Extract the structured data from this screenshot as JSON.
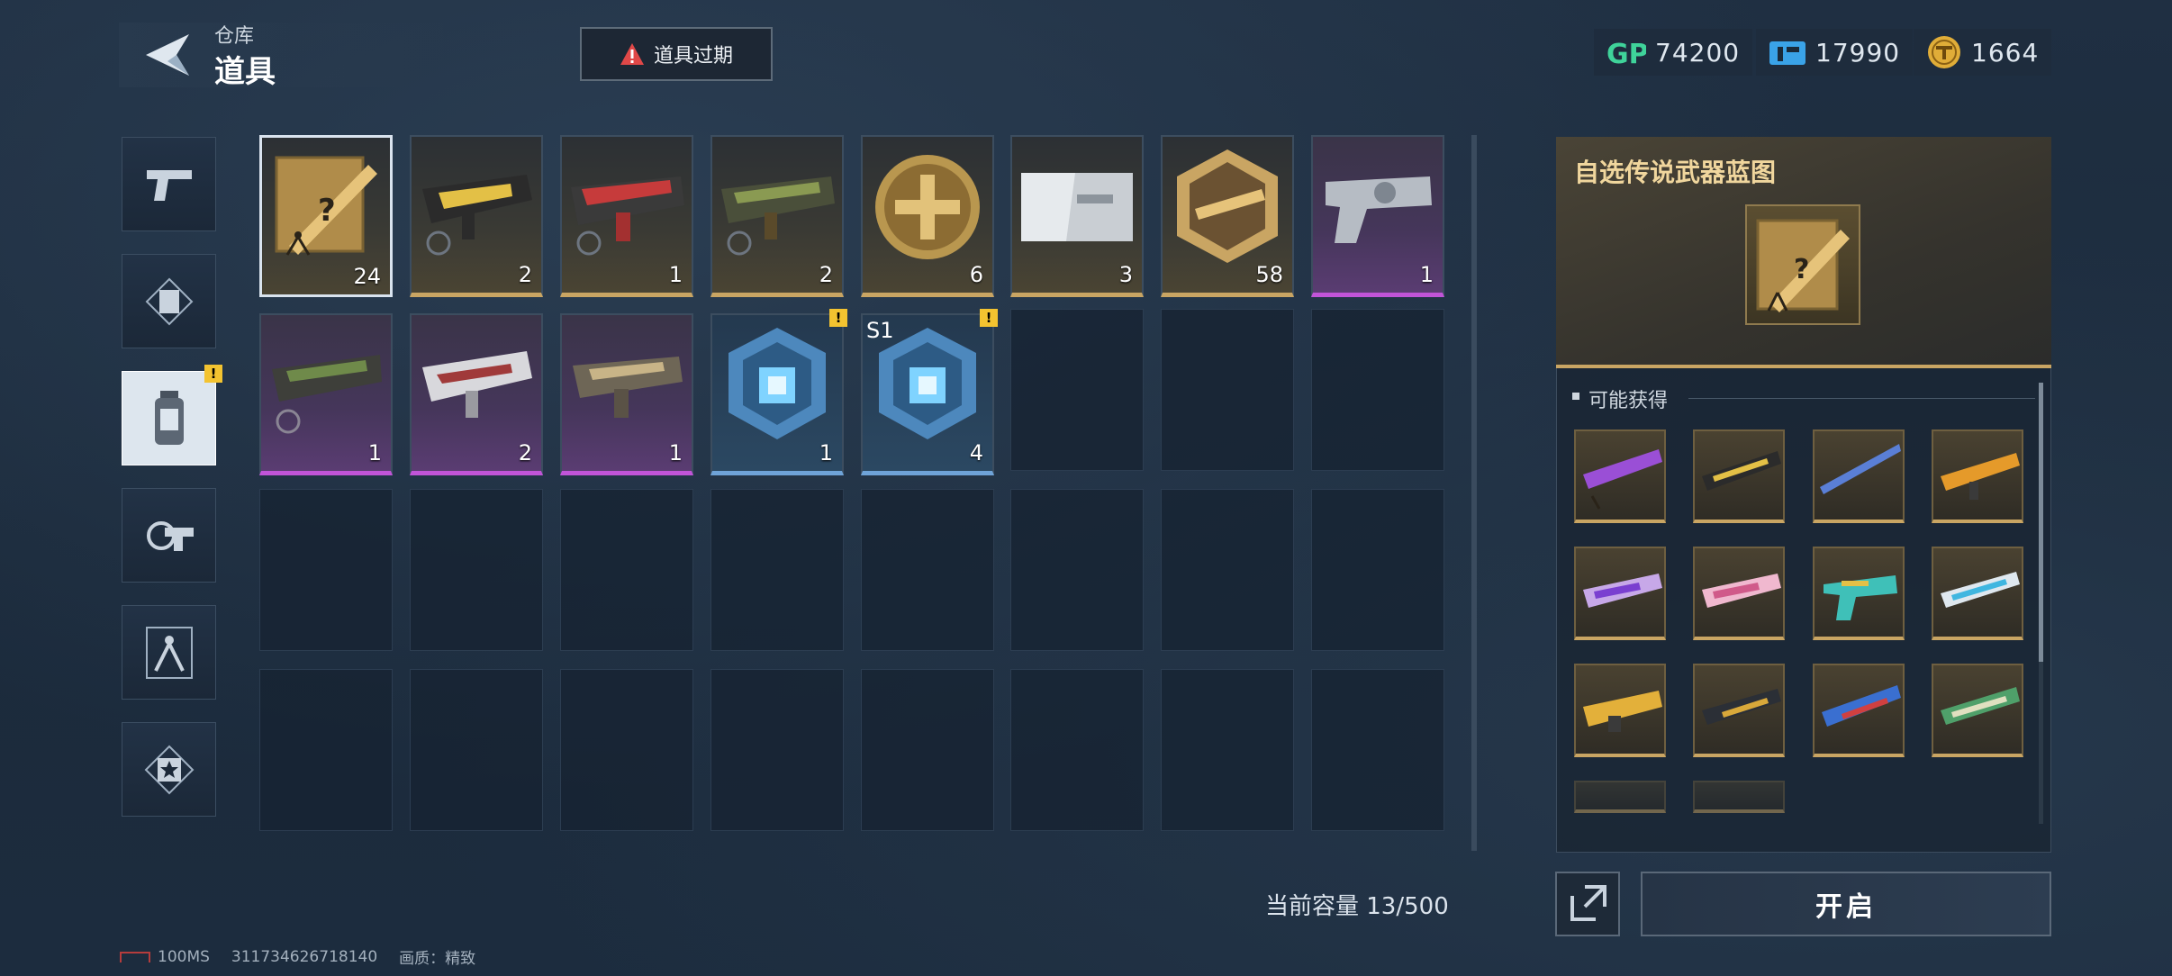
{
  "header": {
    "section": "仓库",
    "title": "道具"
  },
  "alert_button": {
    "label": "道具过期"
  },
  "currencies": [
    {
      "icon": "gp-icon",
      "value": "74200"
    },
    {
      "icon": "ticket-icon",
      "value": "17990"
    },
    {
      "icon": "coin-icon",
      "value": "1664"
    }
  ],
  "categories": [
    {
      "name": "weapons",
      "icon": "pistol-icon",
      "active": false
    },
    {
      "name": "skins",
      "icon": "frame-icon",
      "active": false
    },
    {
      "name": "consumables",
      "icon": "canister-icon",
      "active": true,
      "badge": "!"
    },
    {
      "name": "attachments",
      "icon": "gear-gun-icon",
      "active": false
    },
    {
      "name": "blueprints",
      "icon": "compass-icon",
      "active": false
    },
    {
      "name": "badges",
      "icon": "star-badge-icon",
      "active": false
    }
  ],
  "items": [
    {
      "name": "legendary-blueprint-selector",
      "qty": "24",
      "rarity": "gold",
      "selected": true
    },
    {
      "name": "gold-smg",
      "qty": "2",
      "rarity": "gold"
    },
    {
      "name": "red-assault-rifle",
      "qty": "1",
      "rarity": "gold"
    },
    {
      "name": "camo-rifle",
      "qty": "2",
      "rarity": "gold"
    },
    {
      "name": "gold-medal",
      "qty": "6",
      "rarity": "gold"
    },
    {
      "name": "silver-ticket",
      "qty": "3",
      "rarity": "gold"
    },
    {
      "name": "gold-badge",
      "qty": "58",
      "rarity": "gold"
    },
    {
      "name": "silver-pistol",
      "qty": "1",
      "rarity": "purple"
    },
    {
      "name": "green-rifle",
      "qty": "1",
      "rarity": "purple"
    },
    {
      "name": "white-smg",
      "qty": "2",
      "rarity": "purple"
    },
    {
      "name": "tan-carbine",
      "qty": "1",
      "rarity": "purple"
    },
    {
      "name": "blue-crate",
      "qty": "1",
      "rarity": "blue",
      "badge": "!"
    },
    {
      "name": "blue-crate-s1",
      "qty": "4",
      "rarity": "blue",
      "badge": "!",
      "tag": "S1"
    }
  ],
  "capacity": "当前容量 13/500",
  "detail": {
    "title": "自选传说武器蓝图",
    "possible_label": "可能获得",
    "rewards": [
      "purple-rifle",
      "gold-black-rifle",
      "blue-sniper",
      "orange-rifle",
      "purple-smg",
      "pink-smg",
      "teal-pistol",
      "cyan-rifle",
      "gold-lmg",
      "dark-rifle",
      "blue-red-rifle",
      "green-rifle"
    ]
  },
  "open_button": {
    "label": "开启"
  },
  "status_bar": {
    "ping": "100MS",
    "uid": "311734626718140",
    "quality": "画质：精致"
  },
  "colors": {
    "gold": "#c9a563",
    "purple": "#c154d8",
    "blue": "#6fa3d8",
    "alert": "#e04848"
  }
}
